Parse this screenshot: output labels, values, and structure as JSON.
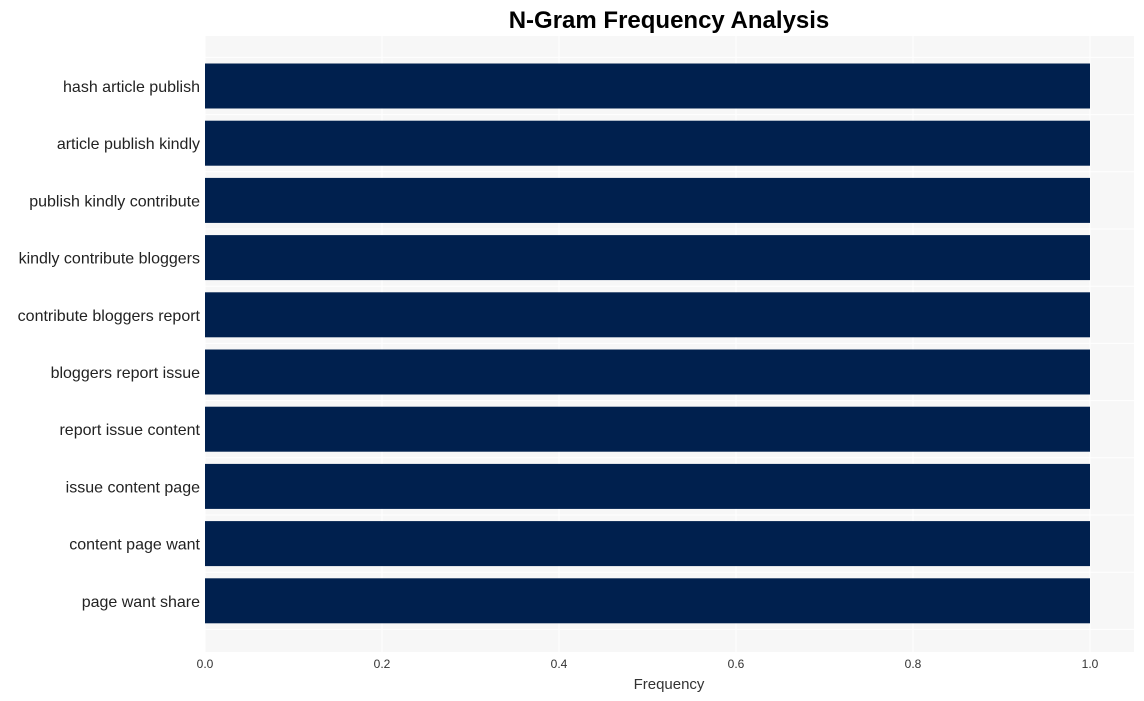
{
  "chart_data": {
    "type": "bar",
    "orientation": "horizontal",
    "title": "N-Gram Frequency Analysis",
    "xlabel": "Frequency",
    "ylabel": "",
    "categories": [
      "hash article publish",
      "article publish kindly",
      "publish kindly contribute",
      "kindly contribute bloggers",
      "contribute bloggers report",
      "bloggers report issue",
      "report issue content",
      "issue content page",
      "content page want",
      "page want share"
    ],
    "values": [
      1,
      1,
      1,
      1,
      1,
      1,
      1,
      1,
      1,
      1
    ],
    "xlim": [
      0,
      1.05
    ],
    "xticks": [
      "0.0",
      "0.2",
      "0.4",
      "0.6",
      "0.8",
      "1.0"
    ],
    "xtick_values": [
      0,
      0.2,
      0.4,
      0.6,
      0.8,
      1.0
    ],
    "grid": true,
    "legend": "none",
    "colors": {
      "bar": "#00204e",
      "plot_bg": "#f7f7f7",
      "grid": "#ffffff"
    }
  }
}
